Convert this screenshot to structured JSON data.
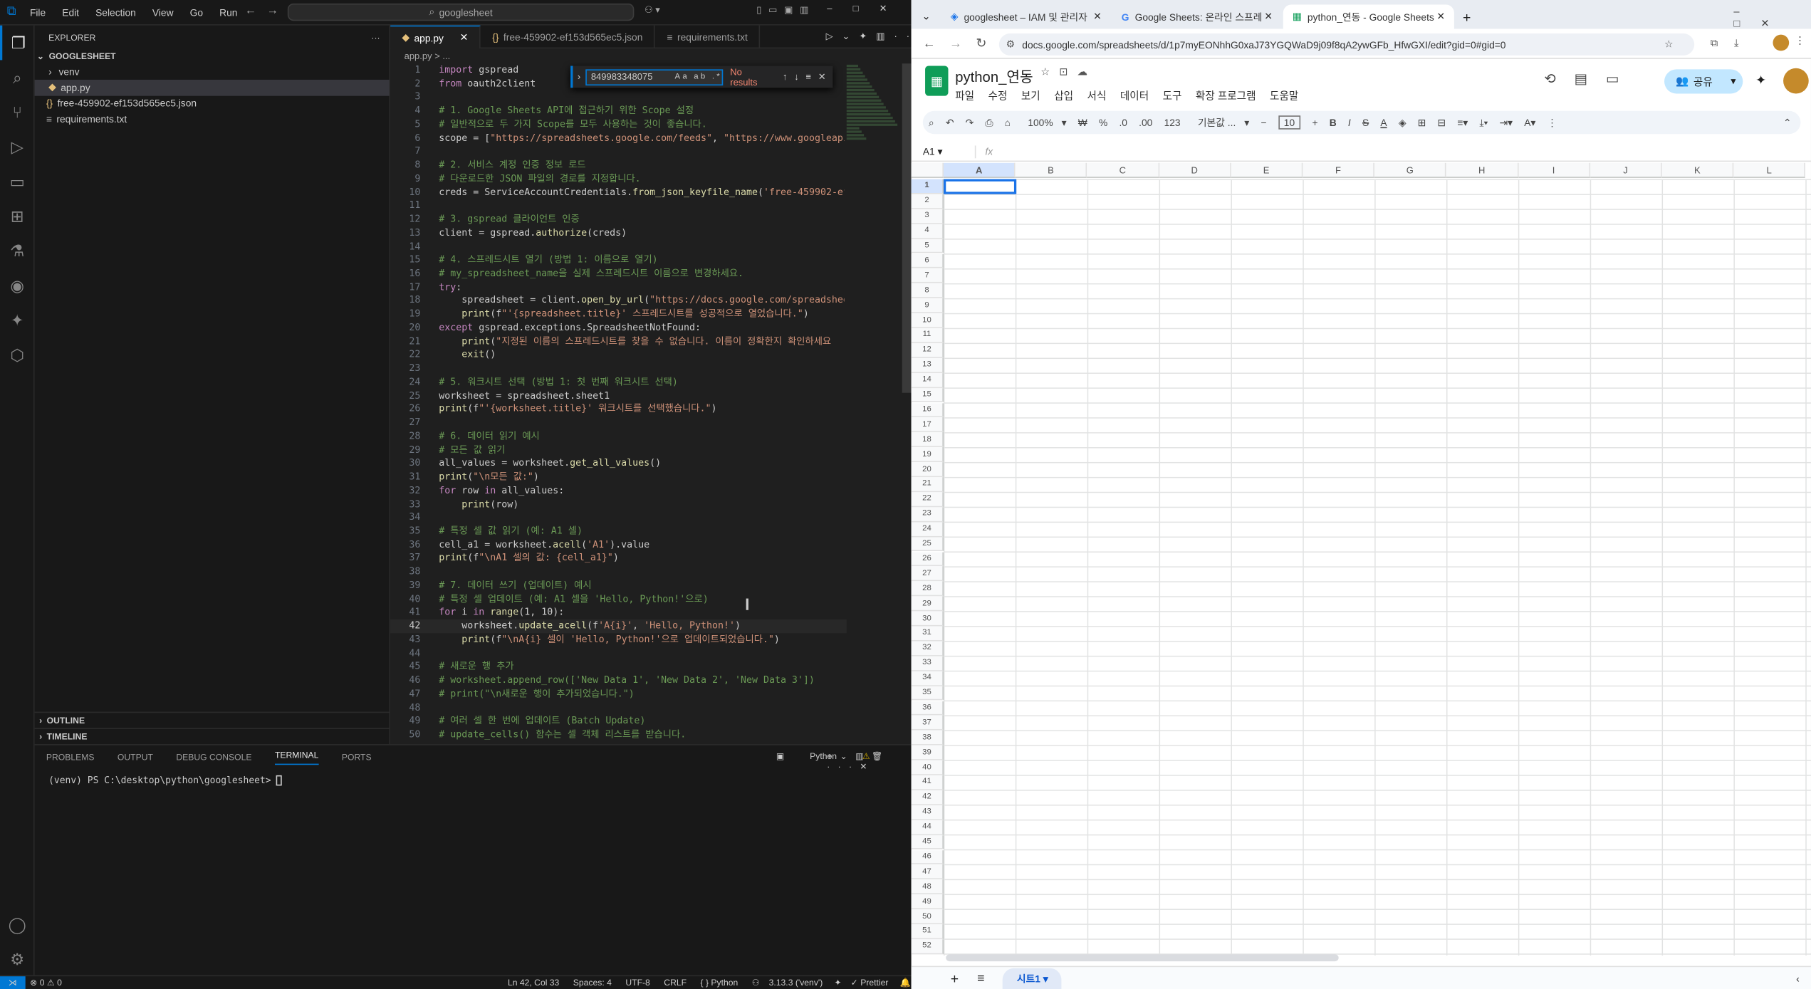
{
  "vscode": {
    "menu": [
      "File",
      "Edit",
      "Selection",
      "View",
      "Go",
      "Run"
    ],
    "command_center": "googlesheet",
    "explorer": {
      "header": "EXPLORER",
      "folder": "GOOGLESHEET",
      "items": [
        "venv",
        "app.py",
        "free-459902-ef153d565ec5.json",
        "requirements.txt"
      ],
      "outline": "OUTLINE",
      "timeline": "TIMELINE"
    },
    "tabs": [
      "app.py",
      "free-459902-ef153d565ec5.json",
      "requirements.txt"
    ],
    "breadcrumb": "app.py > ...",
    "find": {
      "query": "849983348075",
      "result": "No results"
    },
    "code": [
      "import gspread",
      "from oauth2client",
      "",
      "# 1. Google Sheets API에 접근하기 위한 Scope 설정",
      "# 일반적으로 두 가지 Scope를 모두 사용하는 것이 좋습니다.",
      "scope = [\"https://spreadsheets.google.com/feeds\", \"https://www.googleapis.",
      "",
      "# 2. 서비스 계정 인증 정보 로드",
      "# 다운로드한 JSON 파일의 경로를 지정합니다.",
      "creds = ServiceAccountCredentials.from_json_keyfile_name('free-459902-ef15",
      "",
      "# 3. gspread 클라이언트 인증",
      "client = gspread.authorize(creds)",
      "",
      "# 4. 스프레드시트 열기 (방법 1: 이름으로 열기)",
      "# my_spreadsheet_name을 실제 스프레드시트 이름으로 변경하세요.",
      "try:",
      "    spreadsheet = client.open_by_url(\"https://docs.google.com/spreadsheets",
      "    print(f\"'{spreadsheet.title}' 스프레드시트를 성공적으로 열었습니다.\")",
      "except gspread.exceptions.SpreadsheetNotFound:",
      "    print(\"지정된 이름의 스프레드시트를 찾을 수 없습니다. 이름이 정확한지 확인하세요",
      "    exit()",
      "",
      "# 5. 워크시트 선택 (방법 1: 첫 번째 워크시트 선택)",
      "worksheet = spreadsheet.sheet1",
      "print(f\"'{worksheet.title}' 워크시트를 선택했습니다.\")",
      "",
      "# 6. 데이터 읽기 예시",
      "# 모든 값 읽기",
      "all_values = worksheet.get_all_values()",
      "print(\"\\n모든 값:\")",
      "for row in all_values:",
      "    print(row)",
      "",
      "# 특정 셀 값 읽기 (예: A1 셀)",
      "cell_a1 = worksheet.acell('A1').value",
      "print(f\"\\nA1 셀의 값: {cell_a1}\")",
      "",
      "# 7. 데이터 쓰기 (업데이트) 예시",
      "# 특정 셀 업데이트 (예: A1 셀을 'Hello, Python!'으로)",
      "for i in range(1, 10):",
      "    worksheet.update_acell(f'A{i}', 'Hello, Python!')",
      "    print(f\"\\nA{i} 셀이 'Hello, Python!'으로 업데이트되었습니다.\")",
      "",
      "# 새로운 행 추가",
      "# worksheet.append_row(['New Data 1', 'New Data 2', 'New Data 3'])",
      "# print(\"\\n새로운 행이 추가되었습니다.\")",
      "",
      "# 여러 셀 한 번에 업데이트 (Batch Update)",
      "# update_cells() 함수는 셀 객체 리스트를 받습니다."
    ],
    "panel_tabs": [
      "PROBLEMS",
      "OUTPUT",
      "DEBUG CONSOLE",
      "TERMINAL",
      "PORTS"
    ],
    "terminal_label": "Python",
    "terminal_line": "(venv) PS C:\\desktop\\python\\googlesheet> ",
    "status": {
      "errors": "⊗ 0 ⚠ 0",
      "position": "Ln 42, Col 33",
      "spaces": "Spaces: 4",
      "encoding": "UTF-8",
      "eol": "CRLF",
      "lang": "{ } Python",
      "interpreter": "3.13.3 ('venv')",
      "prettier": "✓ Prettier"
    }
  },
  "chrome": {
    "tabs": [
      "googlesheet – IAM 및 관리자",
      "Google Sheets: 온라인 스프레",
      "python_연동 - Google Sheets"
    ],
    "url": "docs.google.com/spreadsheets/d/1p7myEONhhG0xaJ73YGQWaD9j09f8qA2ywGFb_HfwGXI/edit?gid=0#gid=0",
    "doc_title": "python_연동",
    "doc_menu": [
      "파일",
      "수정",
      "보기",
      "삽입",
      "서식",
      "데이터",
      "도구",
      "확장 프로그램",
      "도움말"
    ],
    "share": "공유",
    "toolbar": {
      "zoom": "100%",
      "font": "기본값 ...",
      "size": "10",
      "currency": "₩",
      "percent": "%",
      "decimals_less": ".0",
      "decimals_more": ".00",
      "format": "123"
    },
    "name_box": "A1",
    "fx": "fx",
    "columns": [
      "A",
      "B",
      "C",
      "D",
      "E",
      "F",
      "G",
      "H",
      "I",
      "J",
      "K",
      "L"
    ],
    "rows": 52,
    "sheet_tab": "시트1"
  },
  "accent": {
    "vscode_blue": "#0078d4",
    "sheets_green": "#0f9d58",
    "selection": "#1a73e8"
  }
}
